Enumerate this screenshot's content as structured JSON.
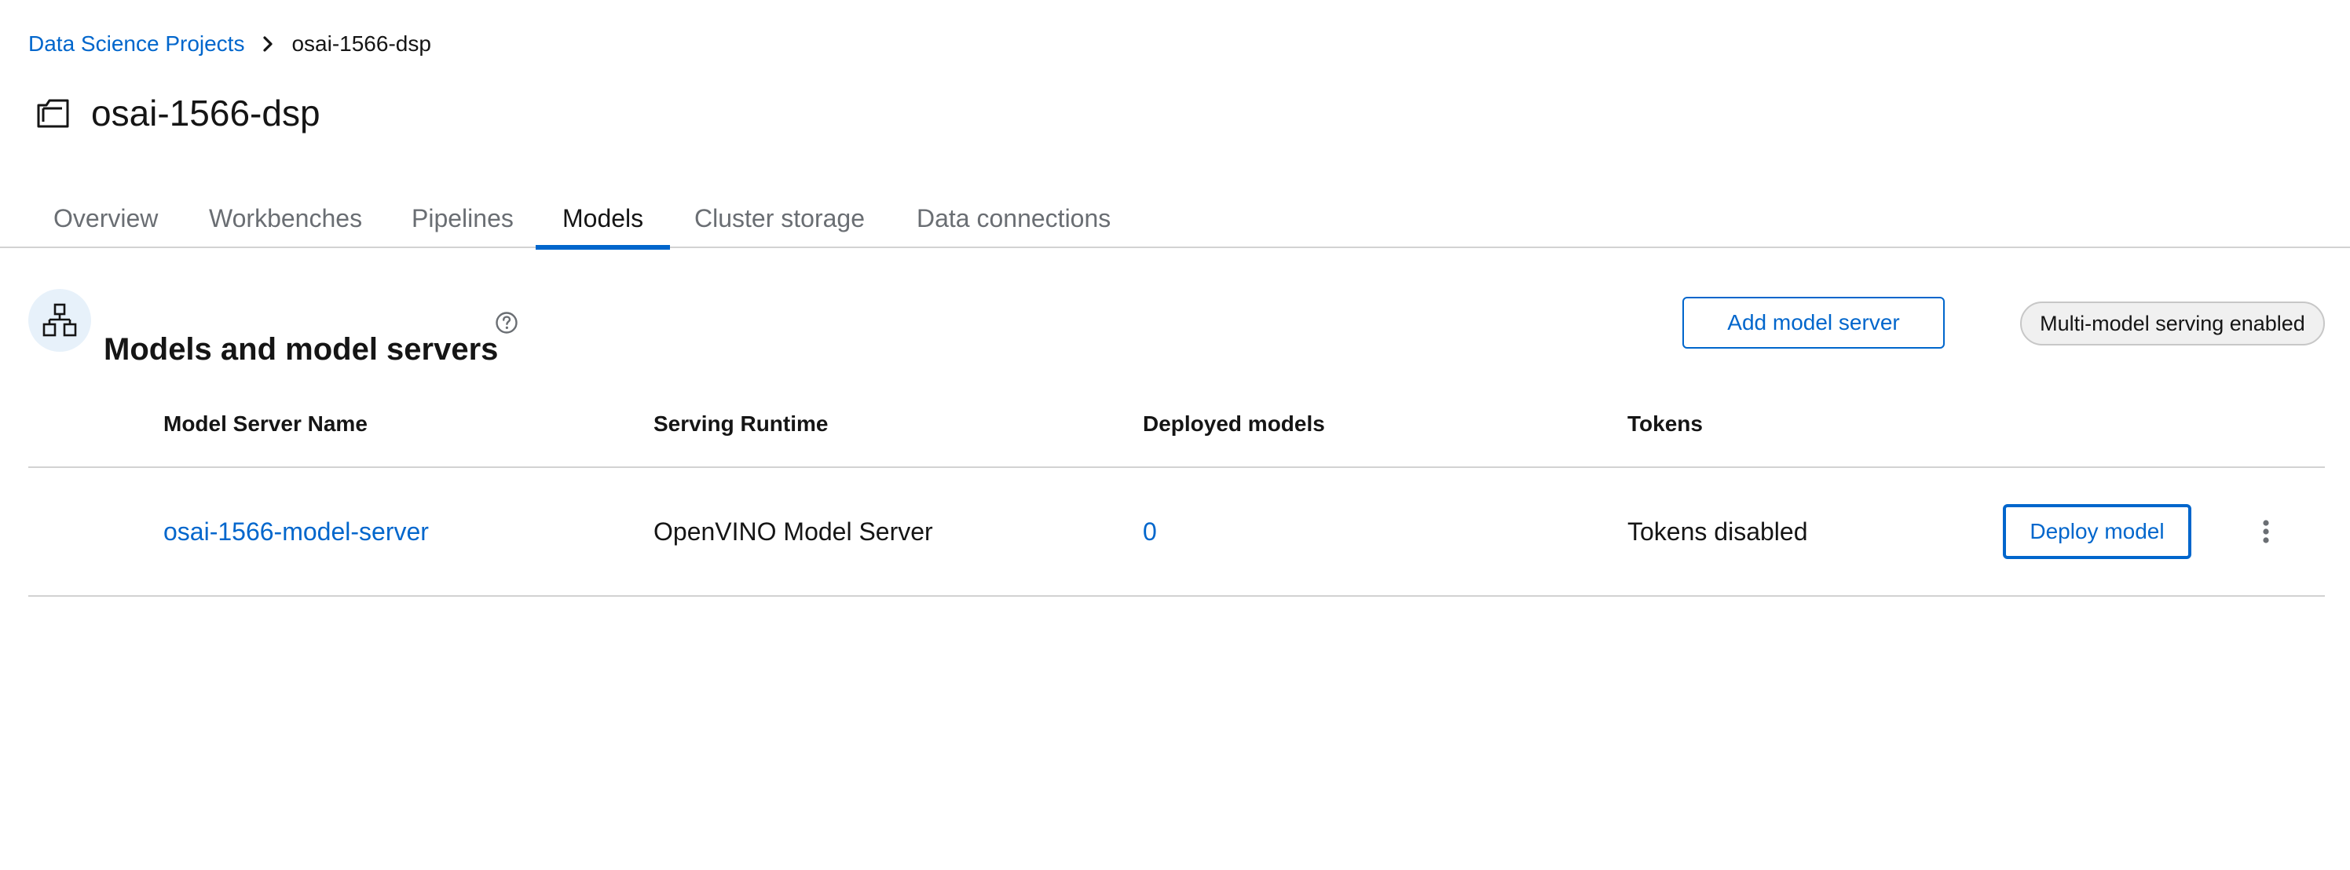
{
  "breadcrumb": {
    "parent": "Data Science Projects",
    "current": "osai-1566-dsp"
  },
  "page": {
    "title": "osai-1566-dsp",
    "title_icon": "folder-icon"
  },
  "tabs": [
    {
      "label": "Overview",
      "active": false
    },
    {
      "label": "Workbenches",
      "active": false
    },
    {
      "label": "Pipelines",
      "active": false
    },
    {
      "label": "Models",
      "active": true
    },
    {
      "label": "Cluster storage",
      "active": false
    },
    {
      "label": "Data connections",
      "active": false
    }
  ],
  "section": {
    "title": "Models and model servers",
    "icon": "model-hierarchy-icon",
    "add_button": "Add model server",
    "badge": "Multi-model serving enabled"
  },
  "table": {
    "columns": [
      "Model Server Name",
      "Serving Runtime",
      "Deployed models",
      "Tokens"
    ],
    "rows": [
      {
        "name": "osai-1566-model-server",
        "runtime": "OpenVINO Model Server",
        "deployed": "0",
        "tokens": "Tokens disabled",
        "action": "Deploy model"
      }
    ]
  },
  "colors": {
    "link": "#0066cc",
    "text": "#151515",
    "muted": "#6a6e73",
    "border": "#d2d2d2",
    "icon_bg": "#e7f1fa"
  }
}
